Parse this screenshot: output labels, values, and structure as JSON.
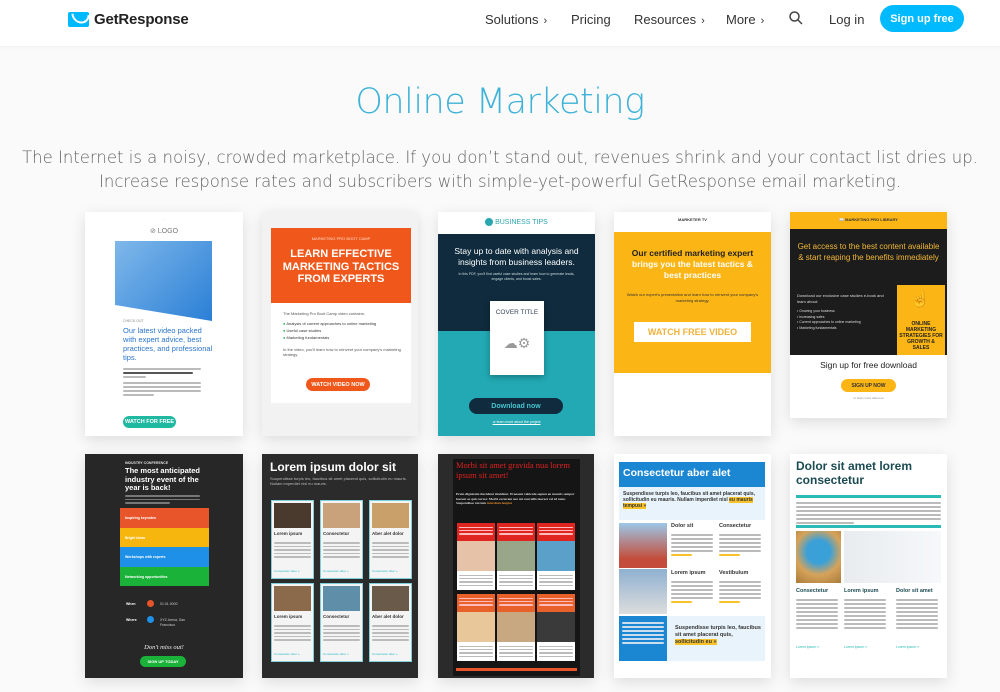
{
  "nav": {
    "brand": "GetResponse",
    "items": [
      {
        "label": "Solutions",
        "chevron": "›"
      },
      {
        "label": "Pricing",
        "chevron": ""
      },
      {
        "label": "Resources",
        "chevron": "›"
      },
      {
        "label": "More",
        "chevron": "›"
      }
    ],
    "search_icon": "search-icon",
    "login": "Log in",
    "signup": "Sign up free",
    "accent": "#00baff"
  },
  "hero": {
    "title": "Online Marketing",
    "subtitle_line1": "The Internet is a noisy, crowded marketplace. If you don’t stand out, revenues shrink and your contact list dries up.",
    "subtitle_line2": "Increase response rates and subscribers with simple-yet-powerful GetResponse email marketing."
  },
  "templates": [
    {
      "name": "checkout-video",
      "logo": "LOGO",
      "kicker": "CHECK OUT",
      "headline": "Our latest video packed with expert advice, best practices, and professional tips.",
      "button": "WATCH FOR FREE"
    },
    {
      "name": "boot-camp",
      "brand": "MARKETING PRO BOOT CAMP",
      "headline": "LEARN EFFECTIVE MARKETING TACTICS FROM EXPERTS",
      "intro": "The Marketing Pro Boot Camp video contains:",
      "bullets": [
        "Analysis of current approaches to online marketing",
        "Useful case studies",
        "Marketing fundamentals"
      ],
      "body": "In the video, you'll learn how to reinvent your company's marketing strategy.",
      "button": "WATCH VIDEO NOW"
    },
    {
      "name": "business-tips",
      "brand": "BUSINESS TIPS",
      "headline": "Stay up to date with analysis and insights from business leaders.",
      "body": "In this PDF, you'll find useful case studies and learn how to generate leads, engage clients, and boost sales.",
      "cover": "COVER TITLE",
      "button": "Download now",
      "link": "or learn more about the project"
    },
    {
      "name": "marketer-tv",
      "brand": "MARKETER TV",
      "headline1": "Our certified marketing expert",
      "headline2": "brings you the latest tactics & best practices",
      "body": "Watch our expert's presentation and learn how to reinvent your company's marketing strategy.",
      "button": "WATCH FREE VIDEO"
    },
    {
      "name": "pro-library",
      "brand": "MARKETING PRO LIBRARY",
      "headline": "Get access to the best content available & start reaping the benefits immediately",
      "intro": "Download our exclusive case studies e-book and learn about:",
      "bullets": [
        "Growing your business",
        "Increasing sales",
        "Current approaches to online marketing",
        "Marketing fundamentals"
      ],
      "book": "ONLINE MARKETING STRATEGIES FOR GROWTH & SALES",
      "cta_title": "Sign up for free download",
      "button": "SIGN UP NOW",
      "link": "or learn more about us"
    },
    {
      "name": "industry-conference",
      "kicker": "INDUSTRY CONFERENCE",
      "headline": "The most anticipated industry event of the year is back!",
      "rows": [
        {
          "label": "Inspiring keynotes",
          "color": "#e8552a"
        },
        {
          "label": "Bright ideas",
          "color": "#f6b60d"
        },
        {
          "label": "Workshops with experts",
          "color": "#1e90e8"
        },
        {
          "label": "Networking opportunities",
          "color": "#1bb23a"
        }
      ],
      "when_label": "When",
      "when_value": "01.01.0000",
      "where_label": "Where",
      "where_value": "XYZ Arena, San Francisco",
      "tagline": "Don't miss out!",
      "button": "SIGN UP TODAY"
    },
    {
      "name": "lorem-grid-dark",
      "headline": "Lorem ipsum dolor sit",
      "body": "Suspendisse turpis leo, faucibus sit amet placerat quis, sollicitudin eu mauris. Nullam imperdiet nisl eu mauris.",
      "items": [
        "Lorem ipsum",
        "Consectetur",
        "Aber alet dolor",
        "Lorem ipsum",
        "Consectetur",
        "Aber alet dolor"
      ],
      "link": "Consectetur aber »"
    },
    {
      "name": "morbi-gravida",
      "headline": "Morbi sit amet gravida nua lorem ipsum sit amet!",
      "body": "Proin dignissim tincidunt tincidunt. Praesent vehicula sapien eu mauris semper laoreet ac quis tortor. Morbi eu lorem nec mi convallis laoreet vel id nunc. Suspendisse rutrum",
      "body_link": "interdum feugiat"
    },
    {
      "name": "consectetur-blue",
      "headline": "Consectetur aber alet",
      "intro": "Suspendisse turpis leo, faucibus sit amet placerat quis, sollicitudin eu mauris. Nullam imperdiet nisl",
      "intro_highlight": "eu mauris tempusi »",
      "items": [
        "Dolor sit",
        "Consectetur",
        "Lorem ipsum",
        "Vestibulum"
      ],
      "footer": "Suspendisse turpis leo, faucibus sit amet placerat quis,",
      "footer_highlight": "sollicitudin eu »"
    },
    {
      "name": "dolor-teal",
      "headline": "Dolor sit amet lorem consectetur",
      "items": [
        "Consectetur",
        "Lorem ipsum",
        "Dolor sit amet"
      ],
      "link": "Lorem ipsum »"
    }
  ]
}
